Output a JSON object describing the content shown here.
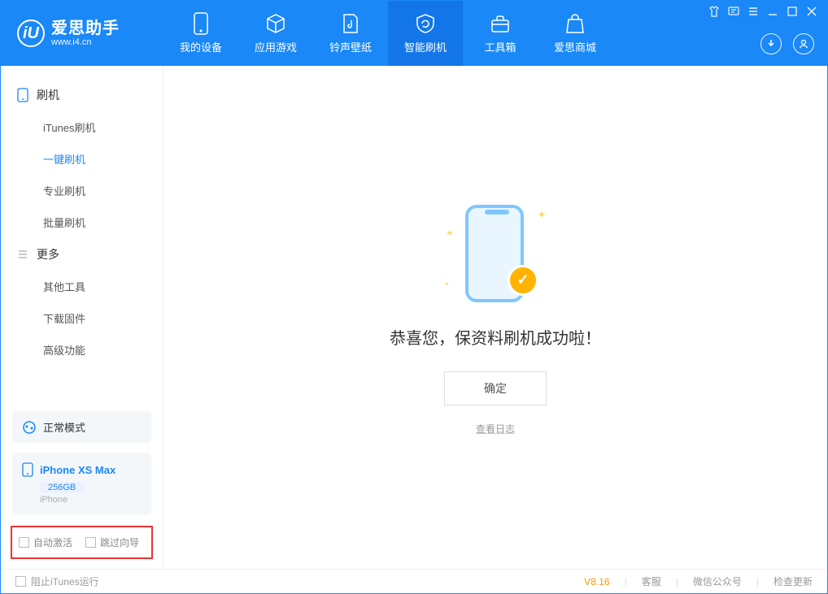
{
  "app": {
    "name": "爱思助手",
    "url": "www.i4.cn"
  },
  "tabs": [
    {
      "label": "我的设备"
    },
    {
      "label": "应用游戏"
    },
    {
      "label": "铃声壁纸"
    },
    {
      "label": "智能刷机"
    },
    {
      "label": "工具箱"
    },
    {
      "label": "爱思商城"
    }
  ],
  "sidebar": {
    "section1": "刷机",
    "items1": [
      "iTunes刷机",
      "一键刷机",
      "专业刷机",
      "批量刷机"
    ],
    "section2": "更多",
    "items2": [
      "其他工具",
      "下载固件",
      "高级功能"
    ],
    "mode": "正常模式",
    "device": {
      "name": "iPhone XS Max",
      "storage": "256GB",
      "type": "iPhone"
    },
    "opt1": "自动激活",
    "opt2": "跳过向导"
  },
  "main": {
    "success_msg": "恭喜您，保资料刷机成功啦！",
    "confirm": "确定",
    "view_log": "查看日志"
  },
  "footer": {
    "block_itunes": "阻止iTunes运行",
    "version": "V8.16",
    "support": "客服",
    "wechat": "微信公众号",
    "update": "检查更新"
  }
}
